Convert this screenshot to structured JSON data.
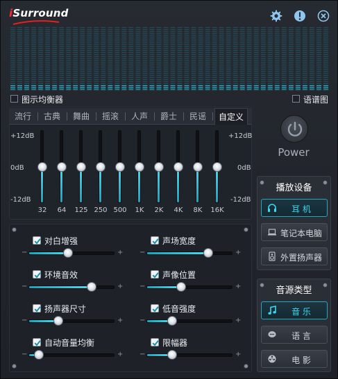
{
  "app": {
    "logo_text": "iSurround"
  },
  "header": {
    "icons": [
      "gear-icon",
      "info-icon",
      "close-icon"
    ]
  },
  "spectrum": {
    "bars": 46
  },
  "options": {
    "show_eq_label": "图示均衡器",
    "show_eq_checked": false,
    "spectrogram_label": "语谱图",
    "spectrogram_checked": false
  },
  "eq": {
    "tabs": [
      {
        "label": "流行"
      },
      {
        "label": "古典"
      },
      {
        "label": "舞曲"
      },
      {
        "label": "摇滚"
      },
      {
        "label": "人声"
      },
      {
        "label": "爵士"
      },
      {
        "label": "民谣"
      },
      {
        "label": "自定义"
      }
    ],
    "active_tab": "自定义",
    "db_labels": {
      "top": "+12dB",
      "mid": "0dB",
      "bottom": "-12dB"
    },
    "bands": [
      {
        "freq": "32",
        "gain_db": 0
      },
      {
        "freq": "64",
        "gain_db": 0
      },
      {
        "freq": "125",
        "gain_db": 0
      },
      {
        "freq": "250",
        "gain_db": 0
      },
      {
        "freq": "500",
        "gain_db": 0
      },
      {
        "freq": "1K",
        "gain_db": 0
      },
      {
        "freq": "2K",
        "gain_db": 0
      },
      {
        "freq": "4K",
        "gain_db": 0
      },
      {
        "freq": "8K",
        "gain_db": 0
      },
      {
        "freq": "16K",
        "gain_db": 0
      }
    ]
  },
  "power": {
    "label": "Power"
  },
  "device": {
    "title": "播放设备",
    "buttons": [
      {
        "label": "耳 机",
        "icon": "headphones-icon",
        "selected": true
      },
      {
        "label": "笔记本电脑",
        "icon": "laptop-icon",
        "selected": false
      },
      {
        "label": "外置扬声器",
        "icon": "speaker-icon",
        "selected": false
      }
    ]
  },
  "source": {
    "title": "音源类型",
    "buttons": [
      {
        "label": "音 乐",
        "icon": "music-note-icon",
        "selected": true
      },
      {
        "label": "语 言",
        "icon": "speech-icon",
        "selected": false
      },
      {
        "label": "电 影",
        "icon": "film-reel-icon",
        "selected": false
      }
    ]
  },
  "effects": {
    "minus": "−",
    "plus": "+",
    "items": [
      {
        "label": "对白增强",
        "checked": true,
        "level": 0.46
      },
      {
        "label": "声场宽度",
        "checked": true,
        "level": 0.72
      },
      {
        "label": "环境音效",
        "checked": true,
        "level": 0.73
      },
      {
        "label": "声像位置",
        "checked": true,
        "level": 0.4
      },
      {
        "label": "扬声器尺寸",
        "checked": true,
        "level": 0.35
      },
      {
        "label": "低音强度",
        "checked": true,
        "level": 0.3
      },
      {
        "label": "自动音量均衡",
        "checked": true,
        "level": 0.12
      },
      {
        "label": "限幅器",
        "checked": true,
        "level": 0.3
      }
    ]
  }
}
